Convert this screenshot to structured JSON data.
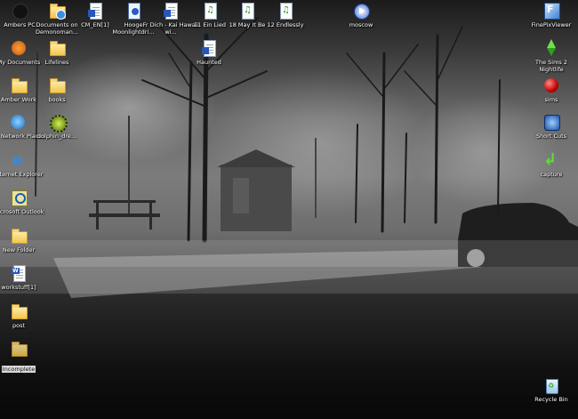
{
  "desktop": {
    "icons_left": [
      {
        "label": "Ambers PC",
        "icon": "computer-cat-icon"
      },
      {
        "label": "My Documents",
        "icon": "my-documents-fox-icon"
      },
      {
        "label": "Amber Work",
        "icon": "briefcase-folder-icon"
      },
      {
        "label": "My Network Places",
        "icon": "network-places-icon"
      },
      {
        "label": "Internet Explorer",
        "icon": "internet-explorer-icon"
      },
      {
        "label": "Microsoft Outlook",
        "icon": "outlook-icon"
      },
      {
        "label": "New Folder",
        "icon": "folder-icon"
      },
      {
        "label": "workstuff[1]",
        "icon": "word-document-icon"
      },
      {
        "label": "post",
        "icon": "folder-icon"
      },
      {
        "label": "Incomplete",
        "icon": "folder-icon",
        "selected": true
      }
    ],
    "icons_col2": [
      {
        "label": "Documents on Demonoman...",
        "icon": "shared-documents-icon"
      },
      {
        "label": "Lifelines",
        "icon": "folder-icon"
      },
      {
        "label": "books",
        "icon": "folder-icon"
      },
      {
        "label": "dolphin_dre...",
        "icon": "dolphin-settings-icon"
      }
    ],
    "icons_top": [
      {
        "label": "CM_EN[1]",
        "icon": "document-icon"
      },
      {
        "label": "Hooge Moonlightdri...",
        "icon": "media-file-icon"
      },
      {
        "label": "Fr Dich - Kai Hawaii wi...",
        "icon": "document-icon"
      },
      {
        "label": "11 Ein Lied",
        "icon": "audio-file-icon"
      },
      {
        "label": "18 May It Be",
        "icon": "audio-file-icon"
      },
      {
        "label": "12 Endlessly",
        "icon": "audio-file-icon"
      },
      {
        "label": "moscow",
        "icon": "media-player-icon"
      }
    ],
    "haunted": {
      "label": "Haunted",
      "icon": "document-icon"
    },
    "icons_right": [
      {
        "label": "FinePixViewer",
        "icon": "finepix-viewer-icon"
      },
      {
        "label": "The Sims 2 Nightlife",
        "icon": "sims-plumbob-icon"
      },
      {
        "label": "sims",
        "icon": "sims-red-ball-icon"
      },
      {
        "label": "Short Cuts",
        "icon": "shortcuts-icon"
      },
      {
        "label": "capture",
        "icon": "capture-arrow-icon"
      }
    ],
    "recycle_bin": {
      "label": "Recycle Bin",
      "icon": "recycle-bin-icon"
    }
  }
}
